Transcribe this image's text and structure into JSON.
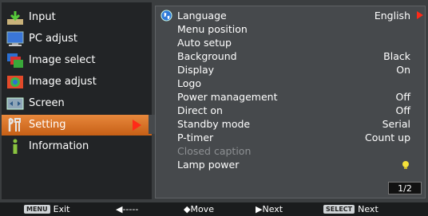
{
  "main_menu": {
    "items": [
      {
        "label": "Input",
        "icon": "input-icon"
      },
      {
        "label": "PC adjust",
        "icon": "pc-adjust-icon"
      },
      {
        "label": "Image select",
        "icon": "image-select-icon"
      },
      {
        "label": "Image adjust",
        "icon": "image-adjust-icon"
      },
      {
        "label": "Screen",
        "icon": "screen-icon"
      },
      {
        "label": "Setting",
        "icon": "setting-icon",
        "selected": true
      },
      {
        "label": "Information",
        "icon": "information-icon"
      }
    ]
  },
  "setting_menu": {
    "rows": [
      {
        "label": "Language",
        "value": "English"
      },
      {
        "label": "Menu position",
        "value": ""
      },
      {
        "label": "Auto setup",
        "value": ""
      },
      {
        "label": "Background",
        "value": "Black"
      },
      {
        "label": "Display",
        "value": "On"
      },
      {
        "label": "Logo",
        "value": ""
      },
      {
        "label": "Power management",
        "value": "Off"
      },
      {
        "label": "Direct on",
        "value": "Off"
      },
      {
        "label": "Standby mode",
        "value": "Serial"
      },
      {
        "label": "P-timer",
        "value": "Count up"
      },
      {
        "label": "Closed caption",
        "value": "",
        "disabled": true
      },
      {
        "label": "Lamp power",
        "value": ""
      }
    ],
    "page": "1/2"
  },
  "footer": {
    "menu_key": "MENU",
    "exit": "Exit",
    "back": "◀-----",
    "move": "◆Move",
    "next_arrow": "▶Next",
    "select_key": "SELECT",
    "select_next": "Next"
  },
  "colors": {
    "accent": "#e07a2c",
    "arrow": "#ff2a18",
    "panel": "#46494c",
    "menu_bg": "#222426"
  }
}
